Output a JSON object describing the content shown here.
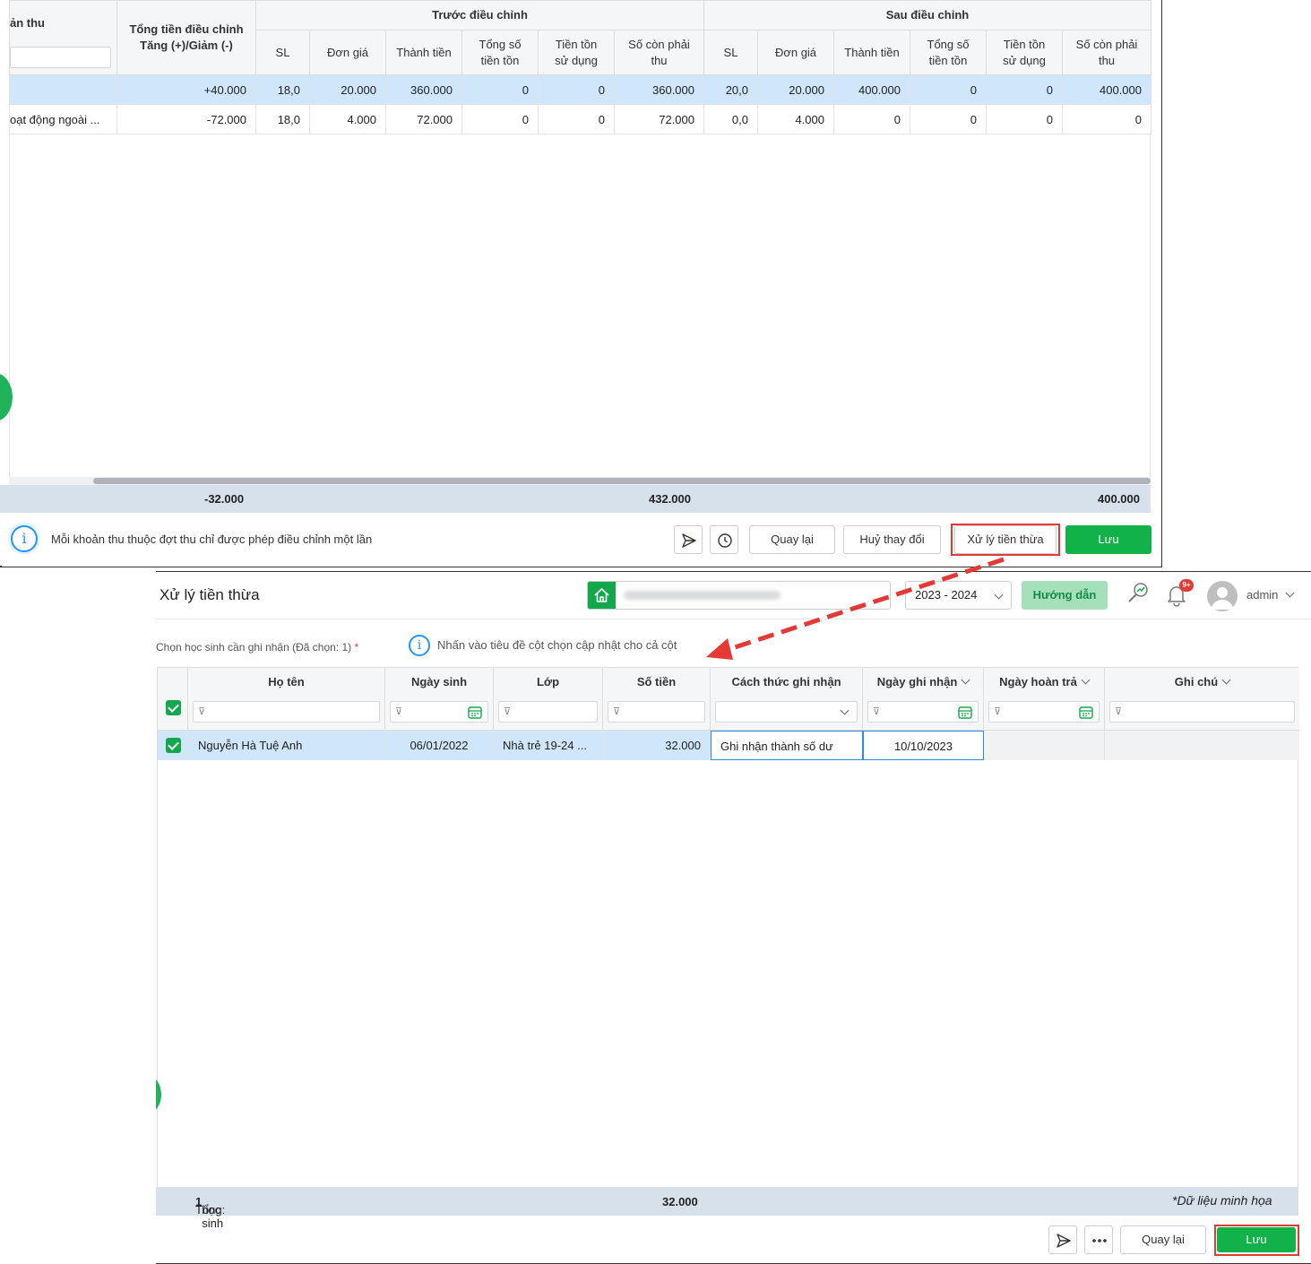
{
  "panel1": {
    "header": {
      "partial_col": "ản thu",
      "adjust_col": "Tổng tiền điều chỉnh Tăng (+)/Giảm (-)",
      "group_before": "Trước điều chỉnh",
      "group_after": "Sau điều chỉnh",
      "sub_cols": [
        "SL",
        "Đơn giá",
        "Thành tiền",
        "Tổng số tiền tồn",
        "Tiền tồn sử dụng",
        "Số còn phải thu"
      ]
    },
    "rows": [
      {
        "name": "",
        "adjust": "+40.000",
        "before": [
          "18,0",
          "20.000",
          "360.000",
          "0",
          "0",
          "360.000"
        ],
        "after": [
          "20,0",
          "20.000",
          "400.000",
          "0",
          "0",
          "400.000"
        ]
      },
      {
        "name": "oạt động ngoài ...",
        "adjust": "-72.000",
        "before": [
          "18,0",
          "4.000",
          "72.000",
          "0",
          "0",
          "72.000"
        ],
        "after": [
          "0,0",
          "4.000",
          "0",
          "0",
          "0",
          "0"
        ]
      }
    ],
    "totals": {
      "adjust": "-32.000",
      "before_remaining": "432.000",
      "after_remaining": "400.000"
    },
    "notice": "Mỗi khoản thu thuộc đợt thu chỉ được phép điều chỉnh một lần",
    "buttons": {
      "back": "Quay lại",
      "cancel": "Huỷ thay đổi",
      "process": "Xử lý tiền thừa",
      "save": "Lưu"
    }
  },
  "panel2": {
    "title": "Xử lý tiền thừa",
    "year": "2023 - 2024",
    "guide": "Hướng dẫn",
    "badge": "9+",
    "user": "admin",
    "pick_label": "Chọn học sinh cần ghi nhận (Đã chọn: 1)",
    "required_mark": "*",
    "hint": "Nhấn vào tiêu đề cột chọn cập nhật cho cả cột",
    "columns": {
      "name": "Họ tên",
      "dob": "Ngày sinh",
      "class": "Lớp",
      "amount": "Số tiền",
      "method": "Cách thức ghi nhận",
      "record_date": "Ngày ghi nhận",
      "refund_date": "Ngày hoàn trả",
      "note": "Ghi chú"
    },
    "row": {
      "name": "Nguyễn Hà Tuệ Anh",
      "dob": "06/01/2022",
      "class": "Nhà trẻ 19-24 ...",
      "amount": "32.000",
      "method": "Ghi nhận thành số dư",
      "record_date": "10/10/2023"
    },
    "total_prefix": "Tổng:",
    "total_count": "1",
    "total_suffix": "học sinh",
    "total_amount": "32.000",
    "watermark": "*Dữ liệu minh họa",
    "buttons": {
      "back": "Quay lại",
      "save": "Lưu"
    }
  },
  "colors": {
    "green": "#12b24a",
    "selected_row": "#cfe6fb",
    "annotation_red": "#e53935",
    "total_bar": "#d7e1ec"
  }
}
